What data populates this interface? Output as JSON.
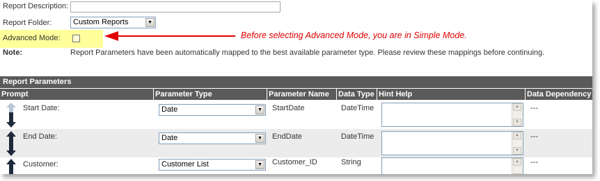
{
  "form": {
    "report_description_label": "Report Description:",
    "report_description_value": "",
    "report_folder_label": "Report Folder:",
    "report_folder_value": "Custom Reports",
    "advanced_mode_label": "Advanced Mode:",
    "advanced_mode_checked": false,
    "note_label": "Note:",
    "note_text": "Report Parameters have been automatically mapped to the best available parameter type. Please review these mappings before continuing."
  },
  "annotation": {
    "text": "Before selecting Advanced Mode, you are in Simple Mode."
  },
  "report_parameters": {
    "section_title": "Report Parameters",
    "columns": [
      "Prompt",
      "Parameter Type",
      "Parameter Name",
      "Data Type",
      "Hint Help",
      "Data Dependency"
    ],
    "rows": [
      {
        "prompt": "Start Date:",
        "parameter_type": "Date",
        "parameter_name": "StartDate",
        "data_type": "DateTime",
        "hint_help": "",
        "data_dependency": "---"
      },
      {
        "prompt": "End Date:",
        "parameter_type": "Date",
        "parameter_name": "EndDate",
        "data_type": "DateTime",
        "hint_help": "",
        "data_dependency": "---"
      },
      {
        "prompt": "Customer:",
        "parameter_type": "Customer List",
        "parameter_name": "Customer_ID",
        "data_type": "String",
        "hint_help": "",
        "data_dependency": "---"
      }
    ]
  },
  "colors": {
    "annotation": "#e00000",
    "highlight": "#ffff9c",
    "header_bg": "#5a5a5a",
    "alt_row": "#ececec"
  },
  "icons": [
    "move-up-arrow-icon",
    "move-down-arrow-icon",
    "dropdown-arrow-icon",
    "scroll-up-icon",
    "scroll-down-icon"
  ]
}
